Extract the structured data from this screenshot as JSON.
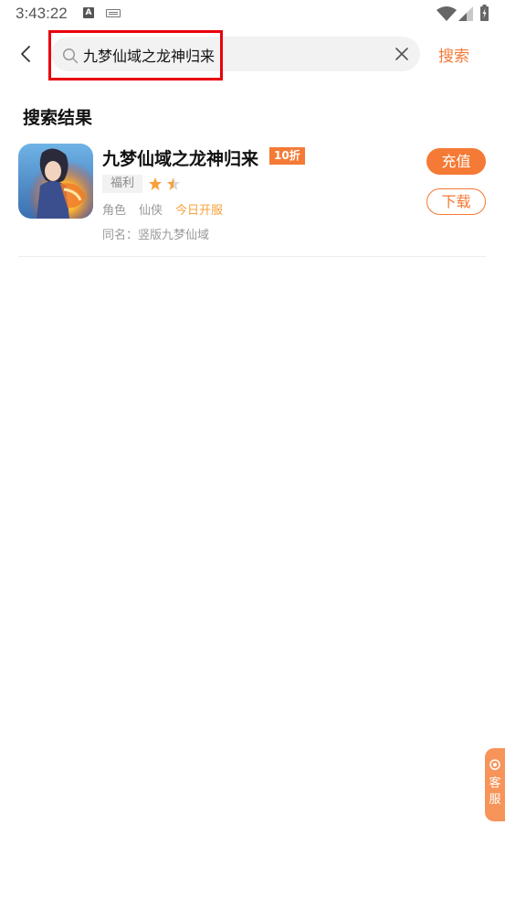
{
  "status_bar": {
    "time": "3:43:22",
    "a_icon": "A",
    "icons": [
      "notification-a-icon",
      "keyboard-icon",
      "wifi-icon",
      "signal-icon",
      "battery-charging-icon"
    ]
  },
  "search": {
    "back_icon": "chevron-left-icon",
    "search_icon": "magnifier-icon",
    "query": "九梦仙域之龙神归来",
    "clear_icon": "close-icon",
    "submit_label": "搜索"
  },
  "results": {
    "section_title": "搜索结果",
    "items": [
      {
        "icon": "game-app-icon",
        "title": "九梦仙域之龙神归来",
        "discount": "10折",
        "badge": "福利",
        "rating": 1.5,
        "rating_max": 2,
        "categories": [
          "角色",
          "仙侠"
        ],
        "server_status": "今日开服",
        "alias": "同名：竖版九梦仙域",
        "primary_action": "充值",
        "secondary_action": "下载"
      }
    ]
  },
  "customer_service": {
    "icon": "chat-bubble-icon",
    "label_line1": "客",
    "label_line2": "服"
  },
  "colors": {
    "accent": "#f47a35",
    "highlight": "#e8000b",
    "star": "#f8a13a",
    "muted_text": "#999999"
  }
}
